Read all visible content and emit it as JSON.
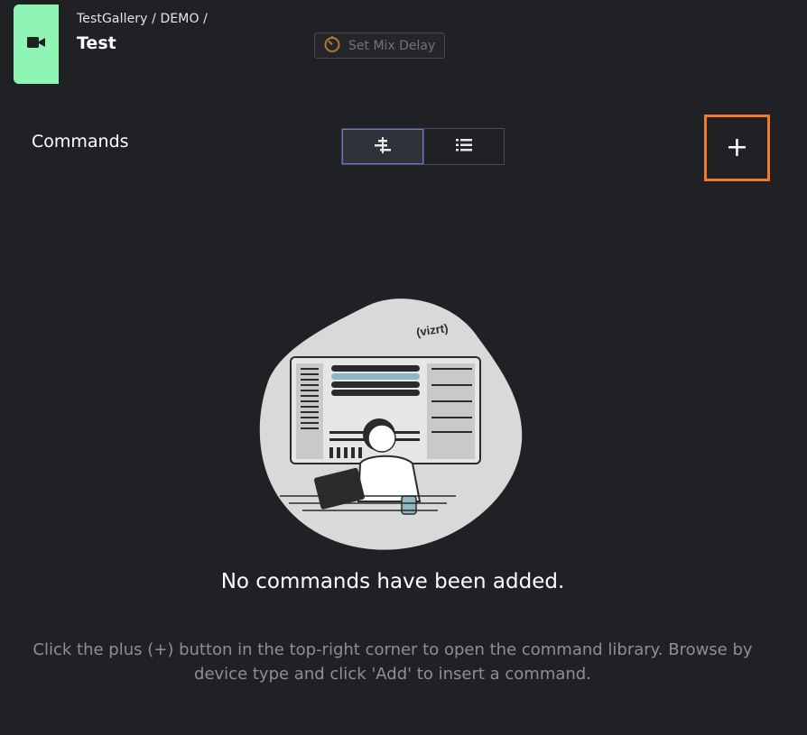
{
  "header": {
    "breadcrumb": "TestGallery / DEMO /",
    "title": "Test",
    "template_icon": "video-camera-icon",
    "mix_delay_icon": "timer-icon",
    "mix_delay_label": "Set Mix Delay",
    "accent_color": "#8ff5b5"
  },
  "commands": {
    "label": "Commands",
    "view_toggle": [
      {
        "icon": "timeline-view-icon",
        "active": true
      },
      {
        "icon": "list-view-icon",
        "active": false
      }
    ],
    "add_button_label": "+",
    "add_button_highlight_color": "#f37a2b"
  },
  "empty_state": {
    "illustration_icon": "person-at-laptop-illustration",
    "illustration_brand": "(vizrt)",
    "title": "No commands have been added.",
    "description": "Click the plus (+) button in the top-right corner to open the command library. Browse by device type and click 'Add' to insert a command."
  }
}
